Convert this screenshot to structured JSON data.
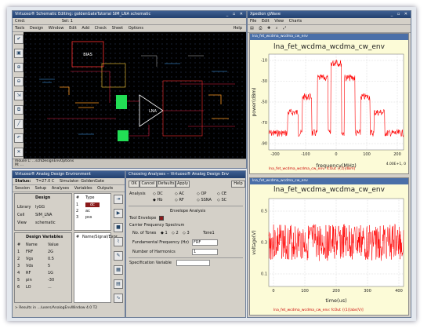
{
  "schematic": {
    "title": "Virtuoso® Schematic Editing: goldenGateTutorial SIM_LNA schematic",
    "cmd": "Cmd:",
    "sel": "Sel: 1",
    "menu": [
      "Tools",
      "Design",
      "Window",
      "Edit",
      "Add",
      "Check",
      "Sheet",
      "Options"
    ],
    "help": "Help",
    "block_label": "LNA",
    "bias_label": "BIAS",
    "status": "mouse L: ...schDesignEnvOptions",
    "status2": "M: ...",
    "status3": "R: ..."
  },
  "wave": {
    "title": "Xpedion gWave",
    "menu": [
      "File",
      "Edit",
      "View",
      "Charts"
    ],
    "plot1": {
      "tab": "lna_fet_wcdma_wcdma_cw_env",
      "heading": "lna_fet_wcdma_wcdma_cw_env",
      "xlabel": "frequency(MHz)",
      "ylabel": "power(dBm)",
      "xticks": [
        "-200",
        "-100",
        "0",
        "100",
        "200"
      ],
      "yticks": [
        "-10",
        "-30",
        "-50",
        "-70",
        "-90"
      ],
      "legend": "lna_fet_wcdma_wcdma_cw_env: fcOut {(1)]dBm]",
      "coord": "4.00E+1, 0"
    },
    "plot2": {
      "tab": "lna_fet_wcdma_wcdma_cw_env",
      "heading": "lna_fet_wcdma_wcdma_cw_env",
      "xlabel": "time(us)",
      "ylabel": "voltage(V)",
      "xticks": [
        "0",
        "100",
        "200",
        "300",
        "400"
      ],
      "yticks": [
        "0.5",
        "0.3",
        "0.1"
      ],
      "legend": "lna_fet_wcdma_wcdma_cw_env: fcOut {(1)]abs(V)]"
    },
    "colors": {
      "trace": "#ff0000",
      "plot_bg": "#ffffff",
      "header_bg": "#fcfbd7"
    }
  },
  "ade": {
    "title": "Virtuoso® Analog Design Environment",
    "status_label": "Status:",
    "status_temp": "T=27.0 C",
    "simulator": "Simulator: GoldenGate",
    "menu": [
      "Session",
      "Setup",
      "Analyses",
      "Variables",
      "Outputs"
    ],
    "design_heading": "Design",
    "library_label": "Library",
    "library_value": "lyGG",
    "cell_label": "Cell",
    "cell_value": "SIM_LNA",
    "view_label": "View",
    "view_value": "schematic",
    "type_col": [
      "#",
      "Type"
    ],
    "types": [
      "1",
      "2",
      "3"
    ],
    "type_vals": [
      "dc",
      "ac",
      "pss"
    ],
    "vars_heading": "Design Variables",
    "vars_cols": [
      "#",
      "Name",
      "Value"
    ],
    "vars": [
      {
        "n": "1",
        "name": "FRF",
        "val": "2G"
      },
      {
        "n": "2",
        "name": "Vgs",
        "val": "0.5"
      },
      {
        "n": "3",
        "name": "Vds",
        "val": "5"
      },
      {
        "n": "4",
        "name": "RF",
        "val": "1G"
      },
      {
        "n": "5",
        "name": "pin",
        "val": "-30"
      },
      {
        "n": "6",
        "name": "LO",
        "val": "..."
      }
    ],
    "outputs_heading": "Outputs",
    "outputs_cols": [
      "#",
      "Name/Signal/Expr"
    ],
    "results": "> Results in .../users/AnalogEnvWindow 4.0 T2"
  },
  "analyses": {
    "title": "Choosing Analyses -- Virtuoso® Analog Design Env",
    "buttons": [
      "OK",
      "Cancel",
      "Defaults",
      "Apply"
    ],
    "help": "Help",
    "analysis_label": "Analysis",
    "types": [
      "DC",
      "AC",
      "OP",
      "CE",
      "Hb",
      "RF",
      "SSNA",
      "SC"
    ],
    "envelope": "Envelope Analysis",
    "tool_env": "Tool Envelope",
    "carrier": "Carrier Frequency Spectrum",
    "tones_label": "No. of Tones",
    "tones_opts": [
      "1",
      "2",
      "3"
    ],
    "tone_btn": "Tone1",
    "fund_label": "Fundamental Frequency (Hz)",
    "fund_val": "FRF",
    "harm_label": "Number of Harmonics",
    "harm_val": "1",
    "spec_label": "Specification Variable"
  }
}
